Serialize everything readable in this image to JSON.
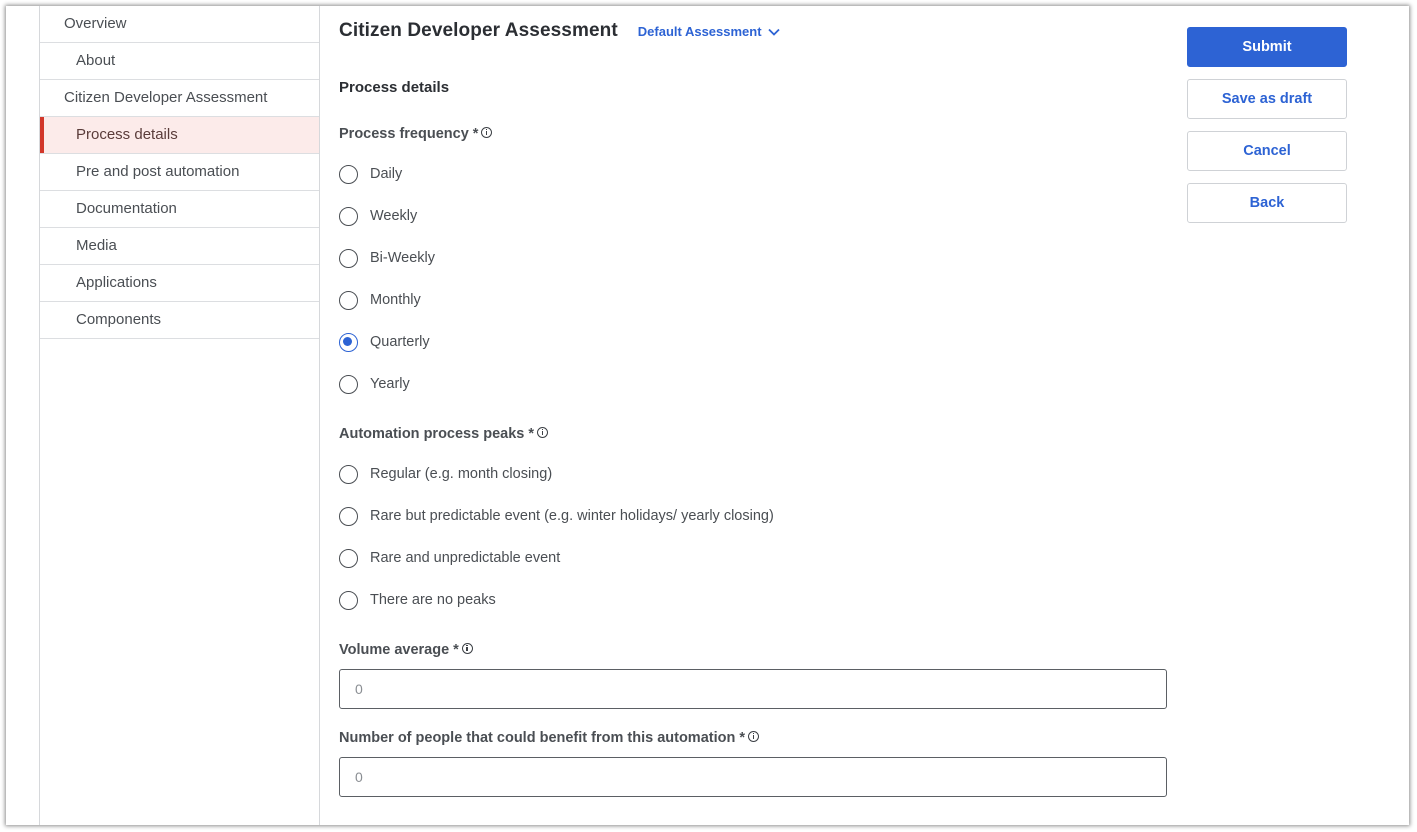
{
  "sidebar": {
    "items": [
      {
        "label": "Overview"
      },
      {
        "label": "About"
      },
      {
        "label": "Citizen Developer Assessment"
      },
      {
        "label": "Process details"
      },
      {
        "label": "Pre and post automation"
      },
      {
        "label": "Documentation"
      },
      {
        "label": "Media"
      },
      {
        "label": "Applications"
      },
      {
        "label": "Components"
      }
    ],
    "active": "Process details"
  },
  "header": {
    "title": "Citizen Developer Assessment",
    "assessment_selector": "Default Assessment"
  },
  "section": {
    "title": "Process details"
  },
  "process_frequency": {
    "label": "Process frequency",
    "required_mark": "*",
    "options": [
      "Daily",
      "Weekly",
      "Bi-Weekly",
      "Monthly",
      "Quarterly",
      "Yearly"
    ],
    "selected": "Quarterly"
  },
  "automation_peaks": {
    "label": "Automation process peaks",
    "required_mark": "*",
    "options": [
      "Regular (e.g. month closing)",
      "Rare but predictable event (e.g. winter holidays/ yearly closing)",
      "Rare and unpredictable event",
      "There are no peaks"
    ],
    "selected": null
  },
  "volume_average": {
    "label": "Volume average",
    "required_mark": "*",
    "placeholder": "0"
  },
  "people_benefit": {
    "label": "Number of people that could benefit from this automation",
    "required_mark": "*",
    "placeholder": "0"
  },
  "actions": {
    "submit": "Submit",
    "save_draft": "Save as draft",
    "cancel": "Cancel",
    "back": "Back"
  },
  "colors": {
    "accent": "#2d63d4",
    "active_nav_bg": "#fcebea",
    "active_nav_marker": "#d2372a"
  },
  "icons": {
    "info": "info-icon",
    "dropdown": "chevron-down-icon"
  }
}
